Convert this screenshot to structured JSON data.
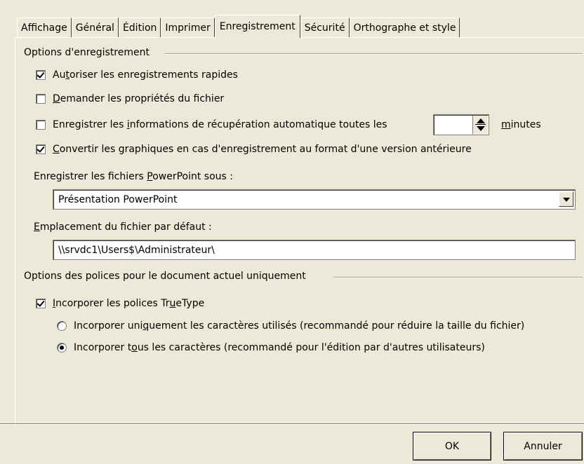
{
  "tabs": [
    {
      "label": "Affichage"
    },
    {
      "label": "Général"
    },
    {
      "label": "Édition"
    },
    {
      "label": "Imprimer"
    },
    {
      "label": "Enregistrement",
      "active": true
    },
    {
      "label": "Sécurité"
    },
    {
      "label": "Orthographe et style"
    }
  ],
  "save_options": {
    "title": "Options d'enregistrement",
    "fast_saves": {
      "pre": "Au",
      "u": "t",
      "post": "oriser les enregistrements rapides",
      "checked": true
    },
    "prompt_props": {
      "pre": "",
      "u": "D",
      "post": "emander les propriétés du fichier",
      "checked": false
    },
    "autorecover": {
      "pre": "Enregistrer les ",
      "u": "i",
      "post": "nformations de récupération automatique toutes les",
      "checked": false
    },
    "autorecover_value": "",
    "minutes": {
      "pre": "",
      "u": "m",
      "post": "inutes"
    },
    "convert_graphics": {
      "pre": "",
      "u": "C",
      "post": "onvertir les graphiques en cas d'enregistrement au format d'une version antérieure",
      "checked": true
    },
    "save_as_label": {
      "pre": "Enregistrer les fichiers ",
      "u": "P",
      "post": "owerPoint sous :"
    },
    "save_as_value": "Présentation PowerPoint",
    "location_label": {
      "pre": "",
      "u": "E",
      "post": "mplacement du fichier par défaut :"
    },
    "location_value": "\\\\srvdc1\\Users$\\Administrateur\\"
  },
  "font_options": {
    "title": "Options des polices pour le document actuel uniquement",
    "embed": {
      "pre": "",
      "u": "I",
      "post": "ncorporer les polices Tr",
      "u2": "u",
      "post2": "eType",
      "checked": true
    },
    "only_used": {
      "pre": "Incorporer uni",
      "u": "q",
      "post": "uement les caractères utilisés  (recommandé pour réduire la taille du fichier)",
      "checked": false
    },
    "all_chars": {
      "pre": "Incorporer t",
      "u": "o",
      "post": "us les caractères (recommandé pour l'édition par d'autres utilisateurs)",
      "checked": true
    }
  },
  "buttons": {
    "ok": "OK",
    "cancel": "Annuler"
  }
}
